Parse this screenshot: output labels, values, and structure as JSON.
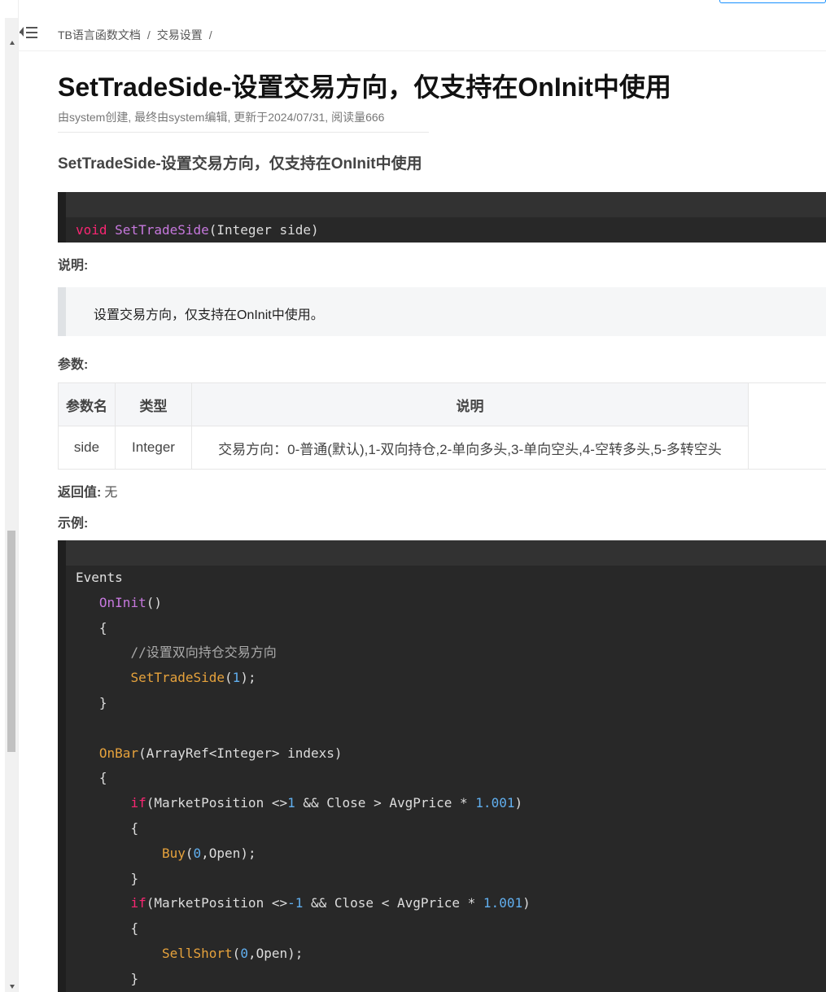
{
  "breadcrumb": {
    "items": [
      "TB语言函数文档",
      "交易设置"
    ],
    "separator": "/"
  },
  "page": {
    "title": "SetTradeSide-设置交易方向，仅支持在OnInit中使用",
    "meta": "由system创建, 最终由system编辑, 更新于2024/07/31, 阅读量666",
    "subtitle": "SetTradeSide-设置交易方向，仅支持在OnInit中使用"
  },
  "signature": {
    "return_type": "void",
    "name": "SetTradeSide",
    "params": "(Integer side)"
  },
  "description": {
    "label": "说明:",
    "text": "设置交易方向，仅支持在OnInit中使用。"
  },
  "parameters": {
    "label": "参数:",
    "headers": [
      "参数名",
      "类型",
      "说明"
    ],
    "rows": [
      [
        "side",
        "Integer",
        "交易方向：0-普通(默认),1-双向持仓,2-单向多头,3-单向空头,4-空转多头,5-多转空头"
      ]
    ]
  },
  "return_value": {
    "label": "返回值:",
    "value": "无"
  },
  "example": {
    "label": "示例:",
    "lines": {
      "l1": "Events",
      "l2_fn": "OnInit",
      "l2_rest": "()",
      "l3": "{",
      "l4": "//设置双向持仓交易方向",
      "l5_fn": "SetTradeSide",
      "l5_open": "(",
      "l5_num": "1",
      "l5_close": ");",
      "l6": "}",
      "l8_fn": "OnBar",
      "l8_rest": "(ArrayRef<Integer> indexs)",
      "l9": "{",
      "l10_kw": "if",
      "l10_a": "(MarketPosition <>",
      "l10_n1": "1",
      "l10_b": " && Close > AvgPrice * ",
      "l10_n2": "1.001",
      "l10_c": ")",
      "l11": "{",
      "l12_fn": "Buy",
      "l12_open": "(",
      "l12_num": "0",
      "l12_rest": ",Open);",
      "l13": "}",
      "l14_kw": "if",
      "l14_a": "(MarketPosition <>",
      "l14_n1": "-1",
      "l14_b": " && Close < AvgPrice * ",
      "l14_n2": "1.001",
      "l14_c": ")",
      "l15": "{",
      "l16_fn": "SellShort",
      "l16_open": "(",
      "l16_num": "0",
      "l16_rest": ",Open);",
      "l17": "}"
    }
  }
}
